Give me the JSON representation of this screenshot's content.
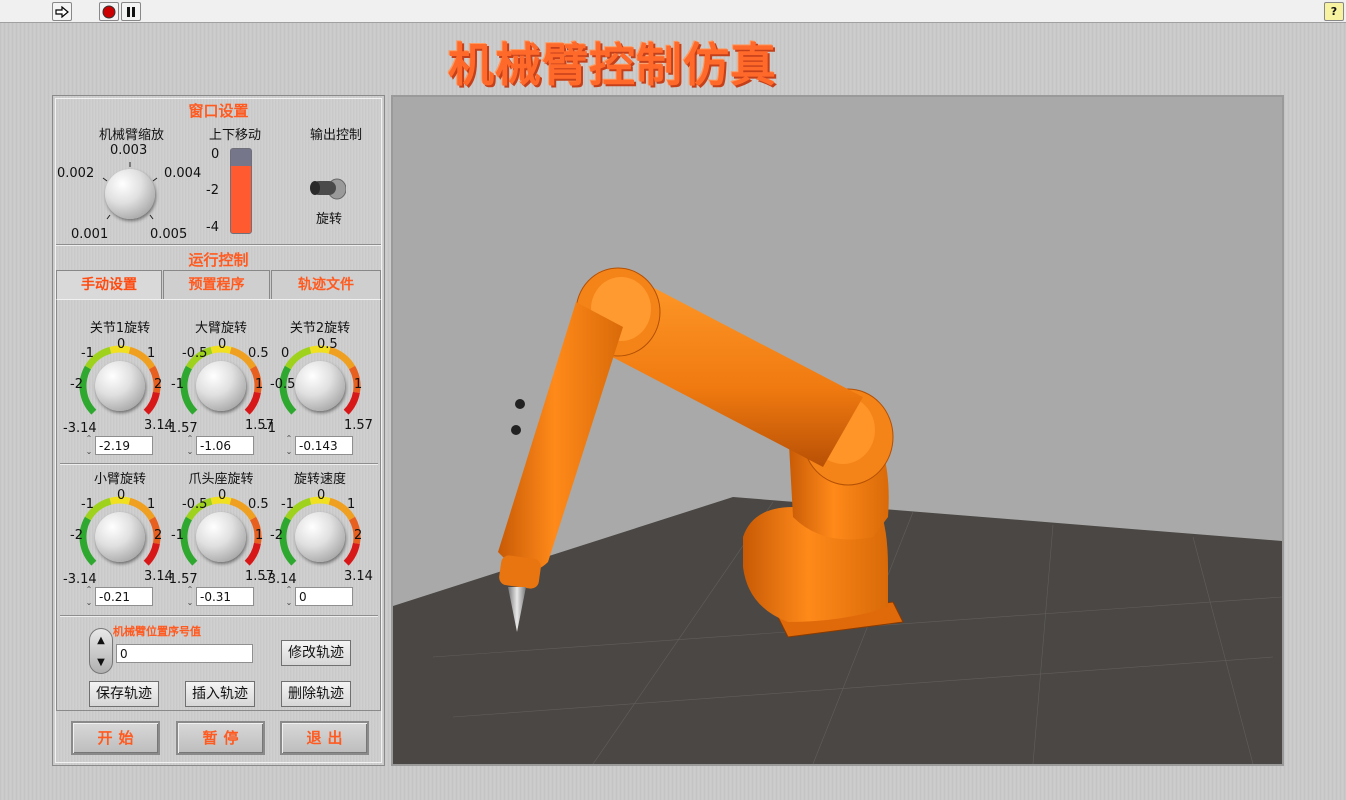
{
  "toolbar": {
    "run_icon": "run-arrow-icon",
    "stop_icon": "stop-icon",
    "pause_icon": "pause-icon",
    "help_label": "?"
  },
  "title": "机械臂控制仿真",
  "window_settings": {
    "title": "窗口设置",
    "zoom": {
      "label": "机械臂缩放",
      "ticks": [
        "0.001",
        "0.002",
        "0.003",
        "0.004",
        "0.005"
      ]
    },
    "vertical": {
      "label": "上下移动",
      "ticks": [
        "0",
        "-2",
        "-4"
      ],
      "min": -4,
      "max": 0,
      "value": -0.8
    },
    "output": {
      "label": "输出控制",
      "switch_label": "旋转"
    }
  },
  "run_control": {
    "title": "运行控制",
    "tabs": [
      "手动设置",
      "预置程序",
      "轨迹文件"
    ],
    "active_tab": 0,
    "joints": [
      {
        "label": "关节1旋转",
        "t_top": "0",
        "t_ul": "-1",
        "t_ur": "1",
        "t_l": "-2",
        "t_r": "2",
        "t_bl": "-3.14",
        "t_br": "3.14",
        "value": "-2.19"
      },
      {
        "label": "大臂旋转",
        "t_top": "0",
        "t_ul": "-0.5",
        "t_ur": "0.5",
        "t_l": "-1",
        "t_r": "1",
        "t_bl": "-1.57",
        "t_br": "1.57",
        "value": "-1.06"
      },
      {
        "label": "关节2旋转",
        "t_top": "0.5",
        "t_ul": "0",
        "t_ur": "",
        "t_l": "-0.5",
        "t_r": "1",
        "t_bl": "-1",
        "t_br": "1.57",
        "value": "-0.143"
      },
      {
        "label": "小臂旋转",
        "t_top": "0",
        "t_ul": "-1",
        "t_ur": "1",
        "t_l": "-2",
        "t_r": "2",
        "t_bl": "-3.14",
        "t_br": "3.14",
        "value": "-0.21"
      },
      {
        "label": "爪头座旋转",
        "t_top": "0",
        "t_ul": "-0.5",
        "t_ur": "0.5",
        "t_l": "-1",
        "t_r": "1",
        "t_bl": "-1.57",
        "t_br": "1.57",
        "value": "-0.31"
      },
      {
        "label": "旋转速度",
        "t_top": "0",
        "t_ul": "-1",
        "t_ur": "1",
        "t_l": "-2",
        "t_r": "2",
        "t_bl": "-3.14",
        "t_br": "3.14",
        "value": "0"
      }
    ],
    "position_index": {
      "label": "机械臂位置序号值",
      "value": "0"
    },
    "buttons": {
      "modify": "修改轨迹",
      "save": "保存轨迹",
      "insert": "插入轨迹",
      "delete": "删除轨迹"
    }
  },
  "actions": {
    "start": "开始",
    "pause": "暂停",
    "exit": "退出"
  },
  "colors": {
    "accent": "#ff5a20",
    "robot": "#f07a10",
    "floor": "#4a4744",
    "sky": "#a9a9a9"
  }
}
